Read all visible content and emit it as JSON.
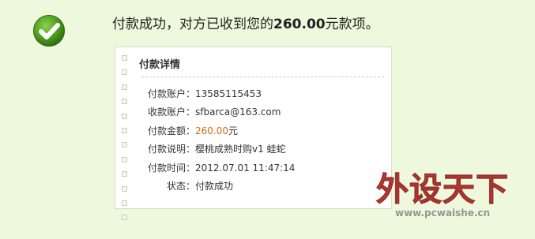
{
  "icons": {
    "success": "check-circle-icon"
  },
  "colors": {
    "page_background": "#eef8dc",
    "success_green": "#4f9e1f",
    "amount_orange": "#d46a10",
    "watermark_red": "#b9261f"
  },
  "header": {
    "prefix": "付款成功，对方已收到您的",
    "amount": "260.00",
    "suffix": "元款项。"
  },
  "details": {
    "title": "付款详情",
    "rows": [
      {
        "label": "付款账户：",
        "value": "13585115453",
        "unit": ""
      },
      {
        "label": "收款账户：",
        "value": "sfbarca@163.com",
        "unit": ""
      },
      {
        "label": "付款金额：",
        "value": "260.00",
        "unit": "元"
      },
      {
        "label": "付款说明：",
        "value": "樱桃成熟时购v1 蛙蛇",
        "unit": ""
      },
      {
        "label": "付款时间：",
        "value": "2012.07.01 11:47:14",
        "unit": ""
      },
      {
        "label": "状态：",
        "value": "付款成功",
        "unit": ""
      }
    ]
  },
  "watermark": {
    "brand": "外设天下",
    "url": "www.pcwaishe.cn"
  }
}
